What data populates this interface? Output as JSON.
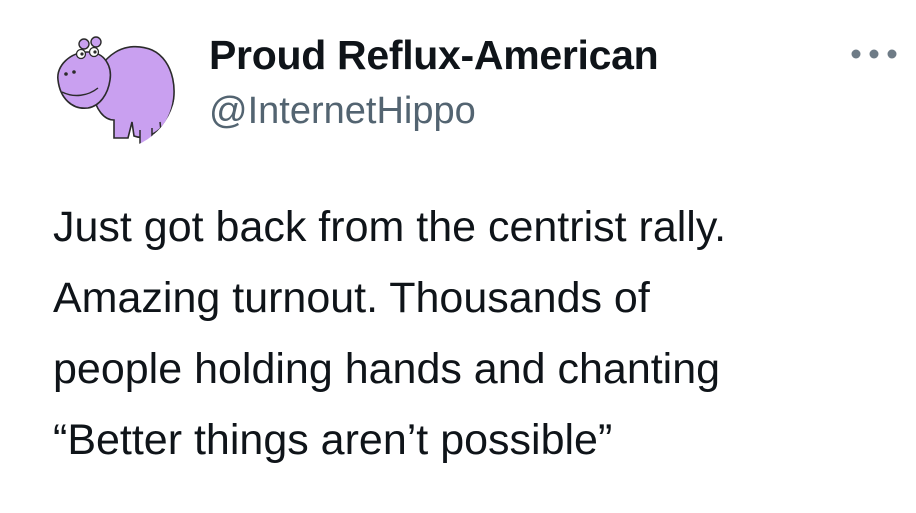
{
  "author": {
    "display_name": "Proud Reflux-American",
    "handle": "@InternetHippo",
    "avatar_icon": "purple-hippo-avatar",
    "avatar_color": "#c9a0f0"
  },
  "more_menu": {
    "icon": "more-horizontal-icon"
  },
  "tweet": {
    "text": "Just got back from the centrist rally.\nAmazing turnout. Thousands of\npeople holding hands and chanting\n“Better things aren’t possible”"
  },
  "colors": {
    "text_primary": "#0f1419",
    "text_secondary": "#536471",
    "icon_gray": "#6e7b86"
  }
}
